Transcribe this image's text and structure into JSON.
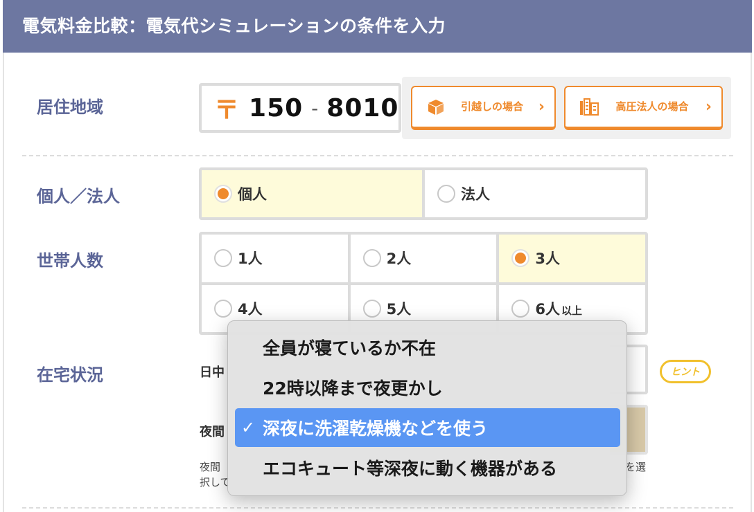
{
  "header": {
    "title": "電気料金比較：電気代シミュレーションの条件を入力"
  },
  "residence": {
    "label": "居住地域",
    "postal_mark": "〒",
    "postal_first": "150",
    "postal_dash": "-",
    "postal_second": "8010",
    "moving_button": "引越しの場合",
    "high_voltage_button": "高圧法人の場合"
  },
  "entity_type": {
    "label": "個人／法人",
    "options": [
      {
        "label": "個人",
        "selected": true
      },
      {
        "label": "法人",
        "selected": false
      }
    ]
  },
  "household": {
    "label": "世帯人数",
    "options": [
      {
        "label": "1人",
        "suffix": "",
        "selected": false
      },
      {
        "label": "2人",
        "suffix": "",
        "selected": false
      },
      {
        "label": "3人",
        "suffix": "",
        "selected": true
      },
      {
        "label": "4人",
        "suffix": "",
        "selected": false
      },
      {
        "label": "5人",
        "suffix": "",
        "selected": false
      },
      {
        "label": "6人",
        "suffix": "以上",
        "selected": false
      }
    ]
  },
  "home_status": {
    "label": "在宅状況",
    "daytime_label": "日中",
    "night_label": "夜間",
    "hint": "ヒント",
    "note_line1_left": "夜間",
    "note_line1_right": "を選",
    "note_line2_left": "択して"
  },
  "dropdown_menu": {
    "items": [
      {
        "label": "全員が寝ているか不在",
        "active": false
      },
      {
        "label": "22時以降まで夜更かし",
        "active": false
      },
      {
        "label": "深夜に洗濯乾燥機などを使う",
        "active": true
      },
      {
        "label": "エコキュート等深夜に動く機器がある",
        "active": false
      }
    ],
    "check_mark": "✓"
  },
  "colors": {
    "header_bg": "#6d77a1",
    "label_text": "#5b6597",
    "accent_orange": "#ef8a2d",
    "selected_bg": "#fefbda",
    "hint_yellow": "#f1c02c",
    "menu_highlight": "#5a96f3"
  },
  "icons": {
    "moving": "box-icon",
    "high_voltage": "building-icon"
  }
}
